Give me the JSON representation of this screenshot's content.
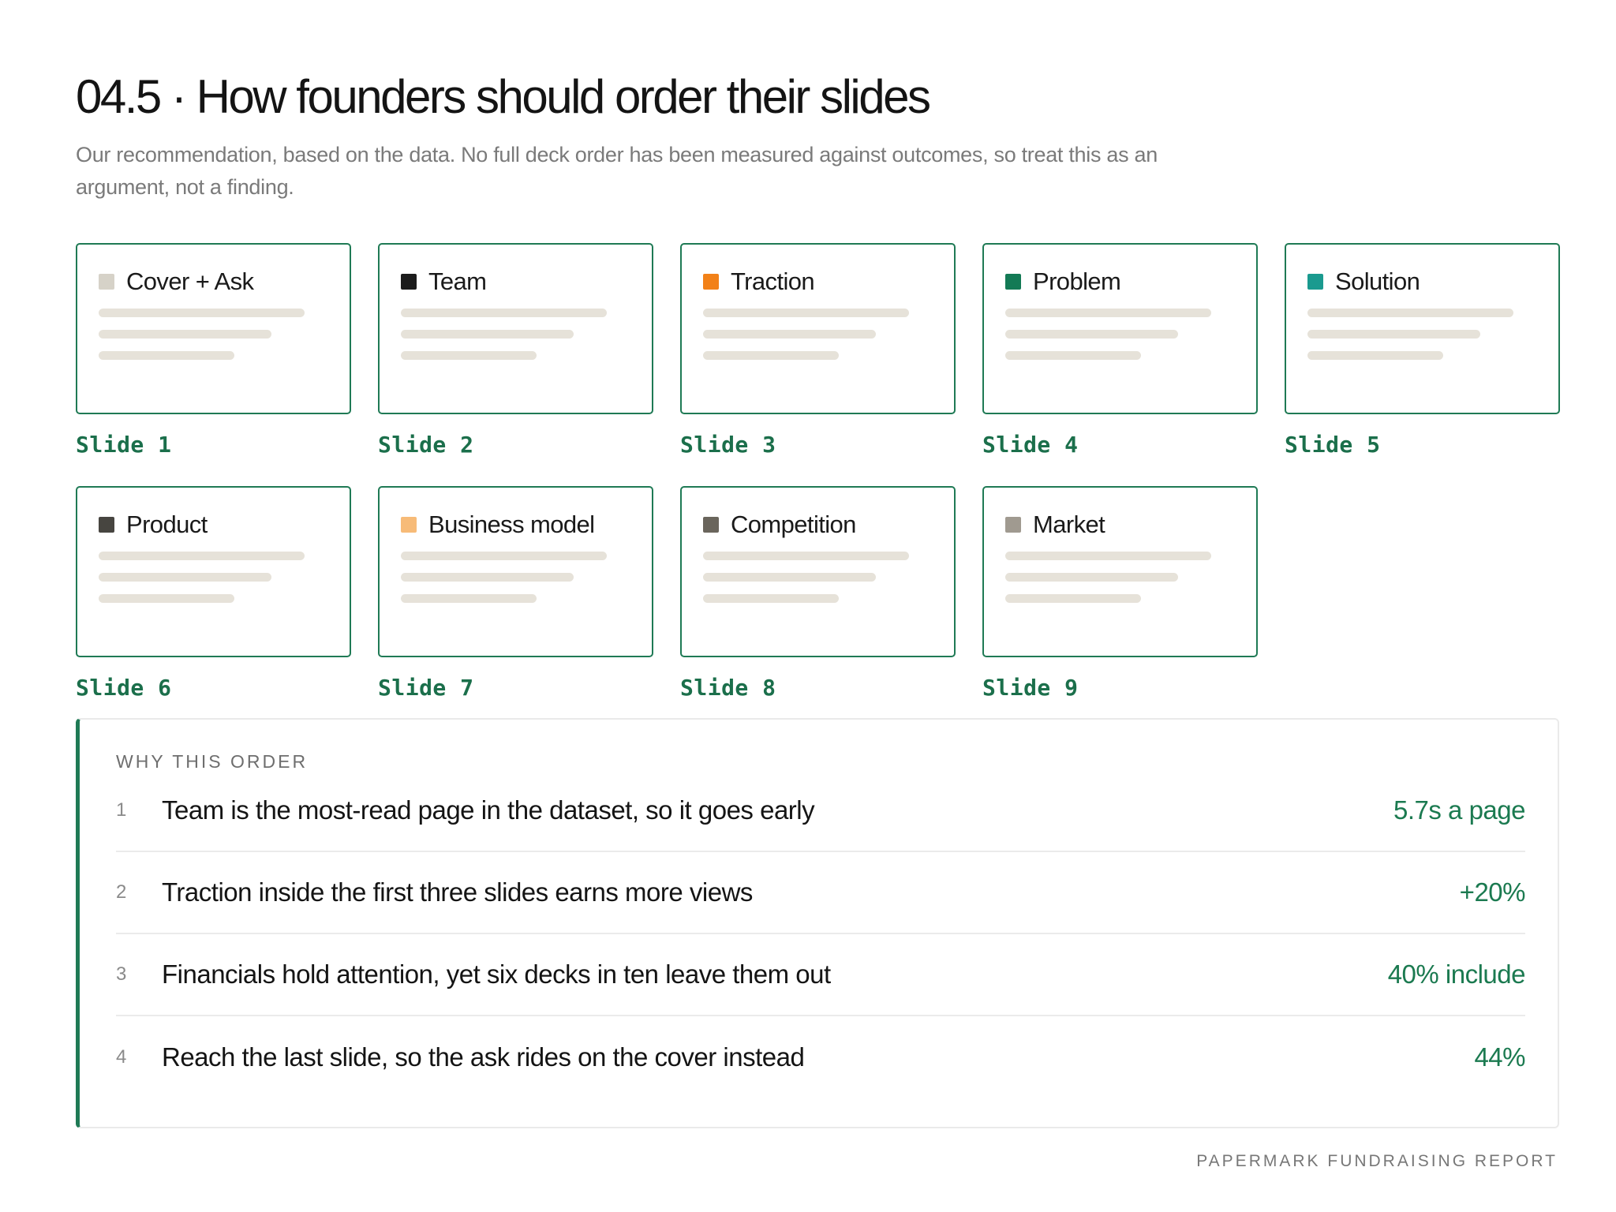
{
  "header": {
    "title": "04.5 · How founders should order their slides",
    "subtitle": "Our recommendation, based on the data. No full deck order has been measured against outcomes, so treat this as an argument, not a finding."
  },
  "slides": [
    {
      "title": "Cover + Ask",
      "label": "Slide 1",
      "color": "#d6d2c8"
    },
    {
      "title": "Team",
      "label": "Slide 2",
      "color": "#1c1c1c"
    },
    {
      "title": "Traction",
      "label": "Slide 3",
      "color": "#f28118"
    },
    {
      "title": "Problem",
      "label": "Slide 4",
      "color": "#137a55"
    },
    {
      "title": "Solution",
      "label": "Slide 5",
      "color": "#1a9a8f"
    },
    {
      "title": "Product",
      "label": "Slide 6",
      "color": "#474540"
    },
    {
      "title": "Business model",
      "label": "Slide 7",
      "color": "#f7bb78"
    },
    {
      "title": "Competition",
      "label": "Slide 8",
      "color": "#6a655c"
    },
    {
      "title": "Market",
      "label": "Slide 9",
      "color": "#a09a90"
    }
  ],
  "why": {
    "heading": "WHY THIS ORDER",
    "reasons": [
      {
        "num": "1",
        "text": "Team is the most-read page in the dataset, so it goes early",
        "stat": "5.7s a page"
      },
      {
        "num": "2",
        "text": "Traction inside the first three slides earns more views",
        "stat": "+20%"
      },
      {
        "num": "3",
        "text": "Financials hold attention, yet six decks in ten leave them out",
        "stat": "40% include"
      },
      {
        "num": "4",
        "text": "Reach the last slide, so the ask rides on the cover instead",
        "stat": "44%"
      }
    ]
  },
  "footer": {
    "text": "PAPERMARK FUNDRAISING REPORT"
  }
}
